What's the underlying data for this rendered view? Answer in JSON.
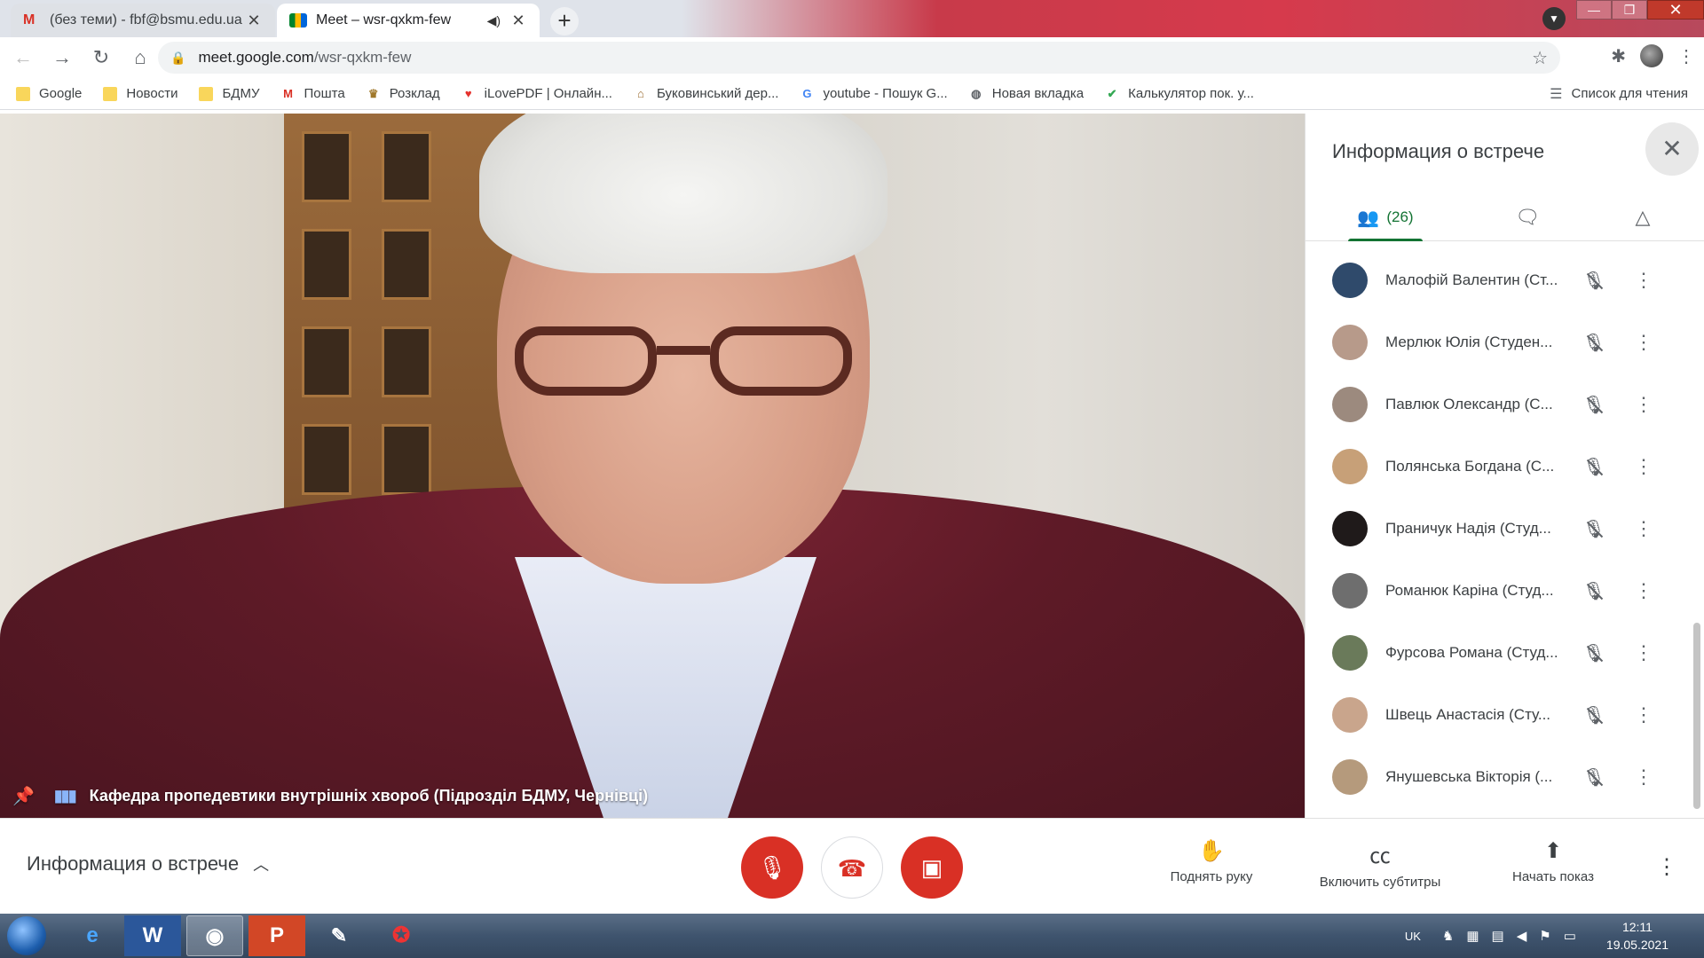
{
  "browser": {
    "tabs": [
      {
        "title": "(без теми) - fbf@bsmu.edu.ua - ",
        "active": false,
        "icon": "gmail-icon"
      },
      {
        "title": "Meet – wsr-qxkm-few",
        "active": true,
        "icon": "meet-icon",
        "audio": true
      }
    ],
    "url_host": "meet.google.com",
    "url_path": "/wsr-qxkm-few",
    "bookmarks": [
      {
        "label": "Google",
        "icon": "folder-icon"
      },
      {
        "label": "Новости",
        "icon": "folder-icon"
      },
      {
        "label": "БДМУ",
        "icon": "folder-icon"
      },
      {
        "label": "Пошта",
        "icon": "gmail-icon"
      },
      {
        "label": "Розклад",
        "icon": "schedule-icon"
      },
      {
        "label": "iLovePDF | Онлайн...",
        "icon": "heart-icon"
      },
      {
        "label": "Буковинський дер...",
        "icon": "building-icon"
      },
      {
        "label": "youtube - Пошук G...",
        "icon": "google-icon"
      },
      {
        "label": "Новая вкладка",
        "icon": "globe-icon"
      },
      {
        "label": "Калькулятор пок. у...",
        "icon": "check-icon"
      }
    ],
    "reading_list": "Список для чтения"
  },
  "video": {
    "speaker_name": "Кафедра пропедевтики внутрішніх хвороб (Підрозділ БДМУ, Чернівці)"
  },
  "panel": {
    "title": "Информация о встрече",
    "people_count": "(26)",
    "participants": [
      {
        "name": "Малофій Валентин (Ст...",
        "avatar_color": "#2f4a6b"
      },
      {
        "name": "Мерлюк Юлія (Студен...",
        "avatar_color": "#b79a8a"
      },
      {
        "name": "Павлюк Олександр (С...",
        "avatar_color": "#9c8a7e"
      },
      {
        "name": "Полянська Богдана (С...",
        "avatar_color": "#c7a078"
      },
      {
        "name": "Праничук Надія (Студ...",
        "avatar_color": "#1f1a1a"
      },
      {
        "name": "Романюк Каріна (Студ...",
        "avatar_color": "#6e6e6e"
      },
      {
        "name": "Фурсова Романа (Студ...",
        "avatar_color": "#6a7a5a"
      },
      {
        "name": "Швець Анастасія (Сту...",
        "avatar_color": "#c9a58c"
      },
      {
        "name": "Янушевська Вікторія (...",
        "avatar_color": "#b59a7c"
      }
    ]
  },
  "controls": {
    "meeting_info": "Информация о встрече",
    "raise_hand": "Поднять руку",
    "captions": "Включить субтитры",
    "present": "Начать показ"
  },
  "taskbar": {
    "lang": "UK",
    "time": "12:11",
    "date": "19.05.2021"
  }
}
